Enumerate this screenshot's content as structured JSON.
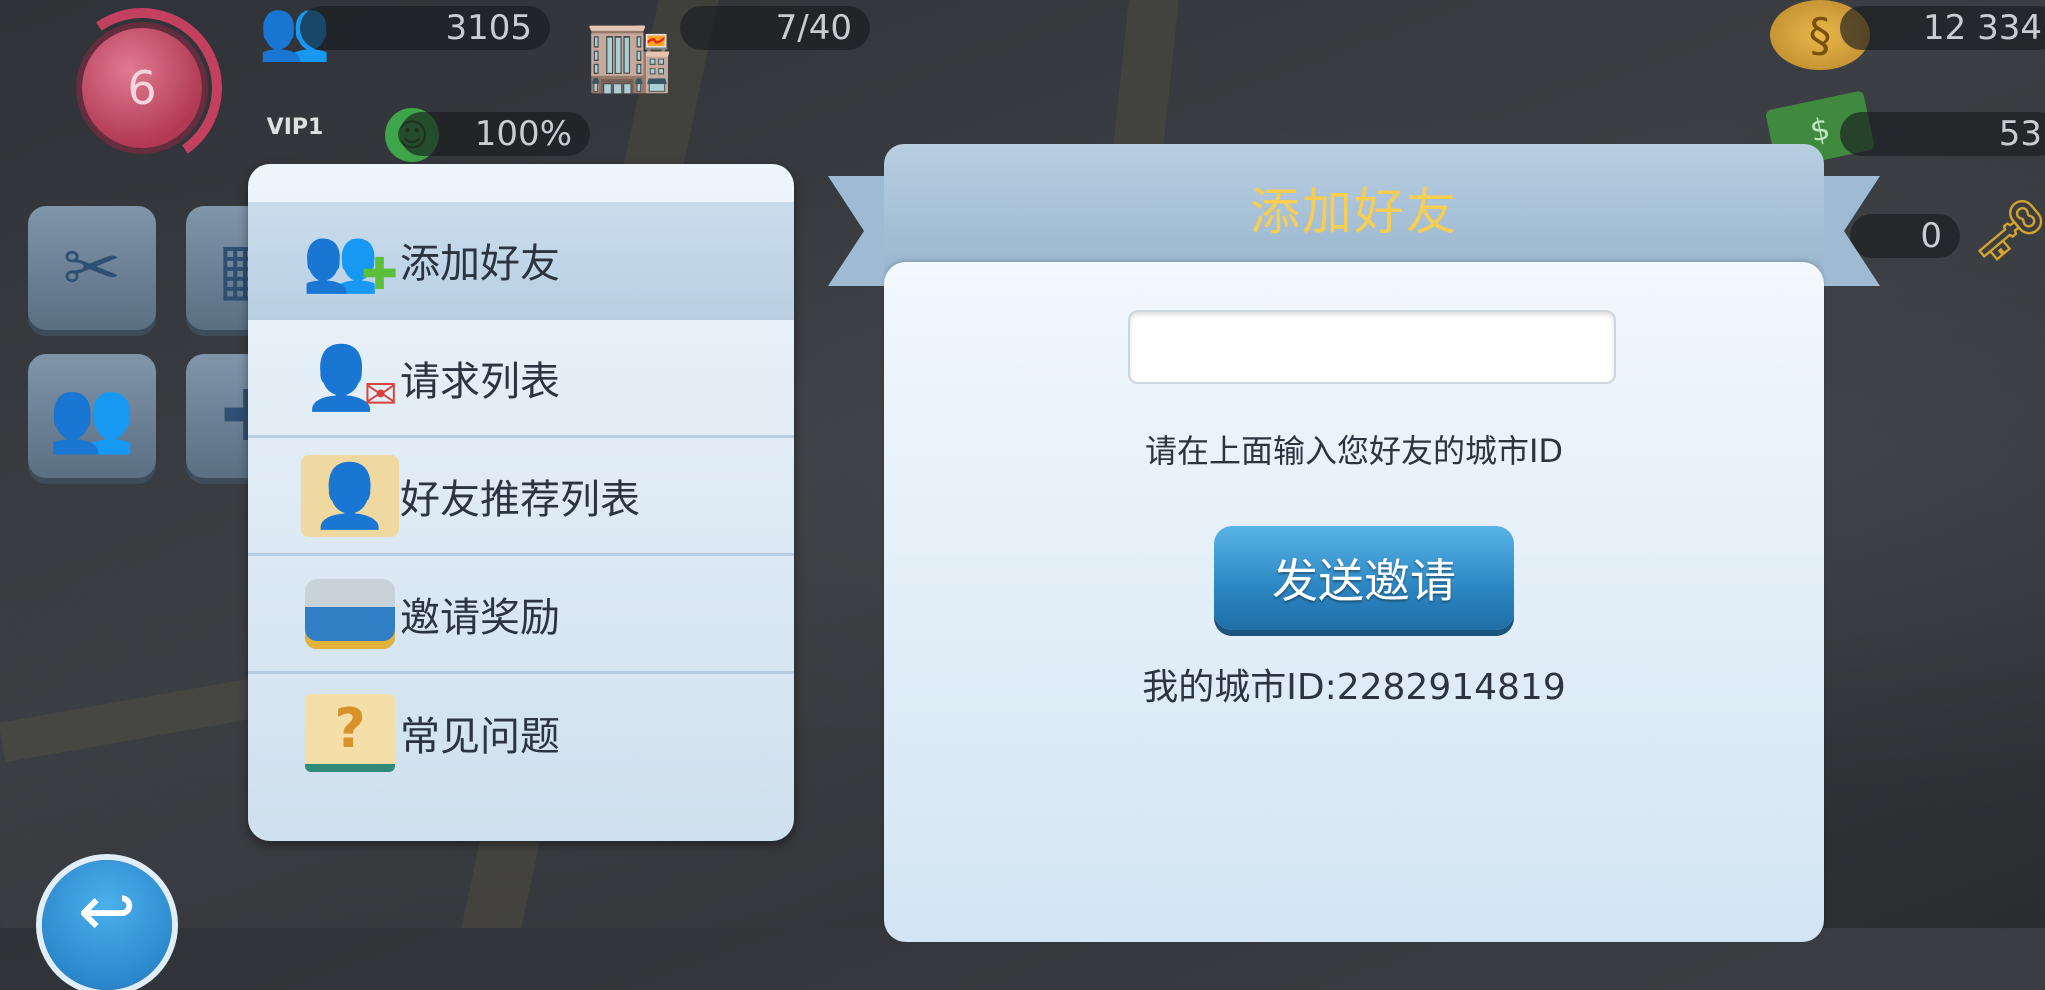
{
  "hud": {
    "level": "6",
    "population": "3105",
    "storage": "7/40",
    "happiness": "100%",
    "vip": "VIP1",
    "simoleons": "12 334",
    "simcash": "53",
    "keys": "0"
  },
  "menu": {
    "items": [
      {
        "label": "添加好友",
        "icon": "add-friend-icon",
        "active": true
      },
      {
        "label": "请求列表",
        "icon": "friend-request-icon"
      },
      {
        "label": "好友推荐列表",
        "icon": "friend-recommend-icon"
      },
      {
        "label": "邀请奖励",
        "icon": "treasure-chest-icon"
      },
      {
        "label": "常见问题",
        "icon": "faq-book-icon"
      }
    ]
  },
  "dialog": {
    "title": "添加好友",
    "input_value": "",
    "hint": "请在上面输入您好友的城市ID",
    "send_label": "发送邀请",
    "my_city_id": "我的城市ID:2282914819"
  },
  "colors": {
    "title": "#f7cd52",
    "button": "#2c86c2"
  }
}
